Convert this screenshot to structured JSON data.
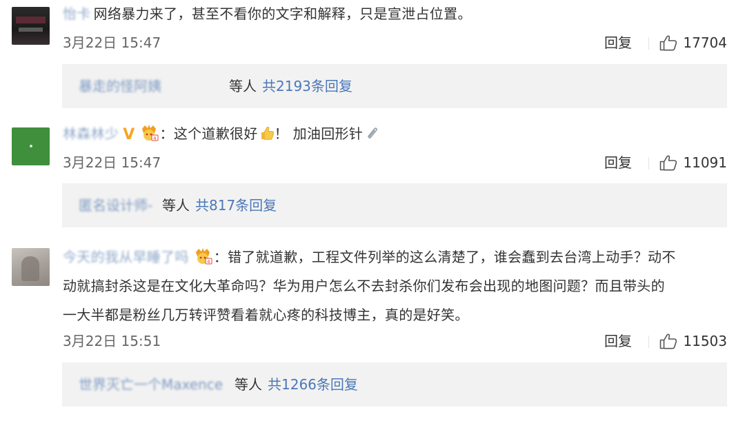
{
  "comments": [
    {
      "username": "怡卡",
      "text": "网络暴力来了，甚至不看你的文字和解释，只是宣泄占位置。",
      "time": "3月22日 15:47",
      "reply_label": "回复",
      "likes": "17704",
      "sub_users": "暴走的怪阿姨",
      "sub_etc": "等人",
      "sub_count": "共2193条回复"
    },
    {
      "username": "林森林少",
      "verified": "V",
      "text": "：这个道歉很好",
      "text2": "！ 加油回形针",
      "time": "3月22日 15:47",
      "reply_label": "回复",
      "likes": "11091",
      "sub_users": "匿名设计师-",
      "sub_etc": "等人",
      "sub_count": "共817条回复"
    },
    {
      "username": "今天的我从早睡了吗",
      "text_lines": [
        "：错了就道歉，工程文件列举的这么清楚了，谁会蠢到去台湾上动手？动不",
        "动就搞封杀这是在文化大革命吗？华为用户怎么不去封杀你们发布会出现的地图问题？而且带头的",
        "一大半都是粉丝几万转评赞看着就心疼的科技博主，真的是好笑。"
      ],
      "time": "3月22日 15:51",
      "reply_label": "回复",
      "likes": "11503",
      "sub_users": "世界灭亡一个Maxence",
      "sub_etc": "等人",
      "sub_count": "共1266条回复"
    }
  ],
  "colors": {
    "link": "#4a77b8",
    "username": "#8fa8c9",
    "verified": "#f5a623",
    "sub_bg": "#f2f2f2"
  },
  "icons": [
    "thumbs-up-icon",
    "crown-badge-icon",
    "verified-icon",
    "thumbs-emoji-icon",
    "paperclip-emoji-icon"
  ]
}
